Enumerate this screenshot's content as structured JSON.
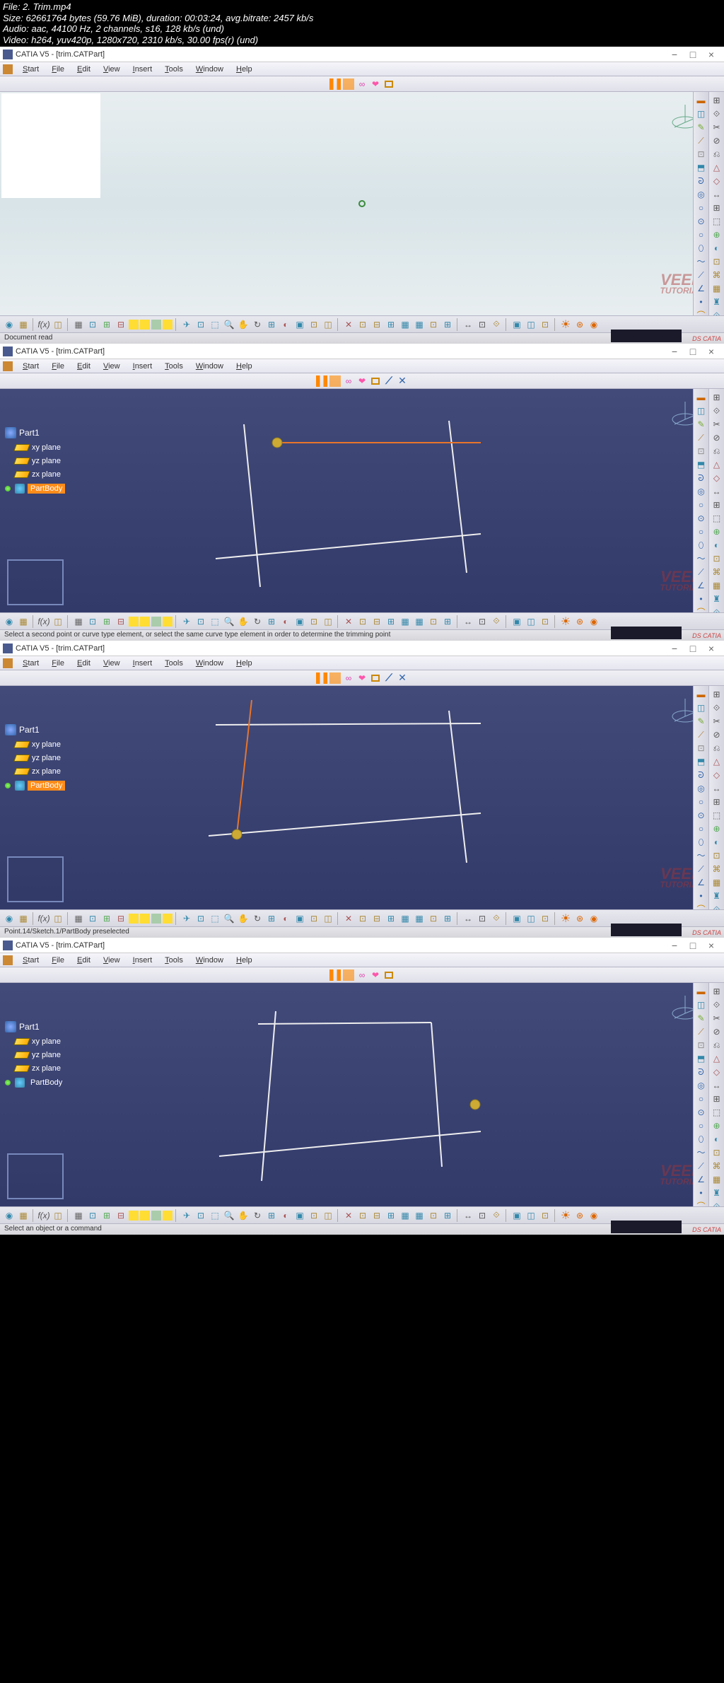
{
  "header": {
    "line1": "File: 2. Trim.mp4",
    "line2": "Size: 62661764 bytes (59.76 MiB), duration: 00:03:24, avg.bitrate: 2457 kb/s",
    "line3": "Audio: aac, 44100 Hz, 2 channels, s16, 128 kb/s (und)",
    "line4": "Video: h264, yuv420p, 1280x720, 2310 kb/s, 30.00 fps(r) (und)"
  },
  "app": {
    "title": "CATIA V5 - [trim.CATPart]",
    "menu": [
      "Start",
      "File",
      "Edit",
      "View",
      "Insert",
      "Tools",
      "Window",
      "Help"
    ]
  },
  "tree": {
    "root": "Part1",
    "planes": [
      "xy plane",
      "yz plane",
      "zx plane"
    ],
    "body": "PartBody"
  },
  "watermark": {
    "main": "VEER",
    "sub": "TUTORIAL"
  },
  "dassault": "DS CATIA",
  "status": {
    "s1": "Document read",
    "s2": "Select a second point or curve type element, or select the same curve type element in order to determine the trimming point",
    "s3": "Point.14/Sketch.1/PartBody preselected",
    "s4": "Select an object or a command"
  }
}
